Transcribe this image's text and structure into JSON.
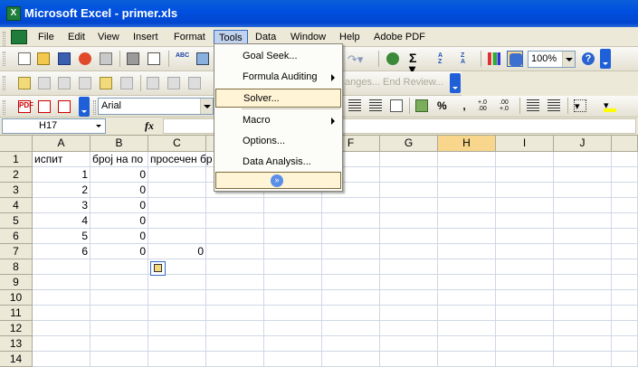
{
  "window": {
    "title": "Microsoft Excel - primer.xls",
    "app_icon": "excel-icon"
  },
  "menubar": {
    "items": [
      "File",
      "Edit",
      "View",
      "Insert",
      "Format",
      "Tools",
      "Data",
      "Window",
      "Help",
      "Adobe PDF"
    ],
    "active": "Tools"
  },
  "toolbar1": {
    "zoom": "100%",
    "buttons": [
      "new",
      "open",
      "save",
      "permission",
      "print-preview",
      "print",
      "spelling",
      "research",
      "autosum",
      "sort-ascending",
      "sort-descending",
      "chart-wizard",
      "drawing",
      "help"
    ]
  },
  "toolbar2": {
    "review_changes": "anges...",
    "end_review": "End Review..."
  },
  "toolbar3": {
    "font": "Arial"
  },
  "formulabar": {
    "namebox": "H17",
    "fx": "fx",
    "value": ""
  },
  "tools_menu": {
    "items": [
      {
        "label": "Goal Seek...",
        "arrow": false
      },
      {
        "label": "Formula Auditing",
        "arrow": true
      },
      {
        "label": "Solver...",
        "arrow": false,
        "highlighted": true
      },
      {
        "label": "Macro",
        "arrow": true
      },
      {
        "label": "Options...",
        "arrow": false
      },
      {
        "label": "Data Analysis...",
        "arrow": false
      }
    ],
    "expand_icon": "expand-chevron-icon"
  },
  "sheet": {
    "columns": [
      "A",
      "B",
      "C",
      "D",
      "E",
      "F",
      "G",
      "H",
      "I",
      "J"
    ],
    "selected_column": "H",
    "rows": [
      "1",
      "2",
      "3",
      "4",
      "5",
      "6",
      "7",
      "8",
      "9",
      "10",
      "11",
      "12",
      "13",
      "14"
    ],
    "cells": {
      "A1": "испит",
      "B1": "број на по",
      "C1": "просечен бр",
      "A2": "1",
      "B2": "0",
      "A3": "2",
      "B3": "0",
      "A4": "3",
      "B4": "0",
      "A5": "4",
      "B5": "0",
      "A6": "5",
      "B6": "0",
      "A7": "6",
      "B7": "0",
      "C7": "0"
    }
  }
}
